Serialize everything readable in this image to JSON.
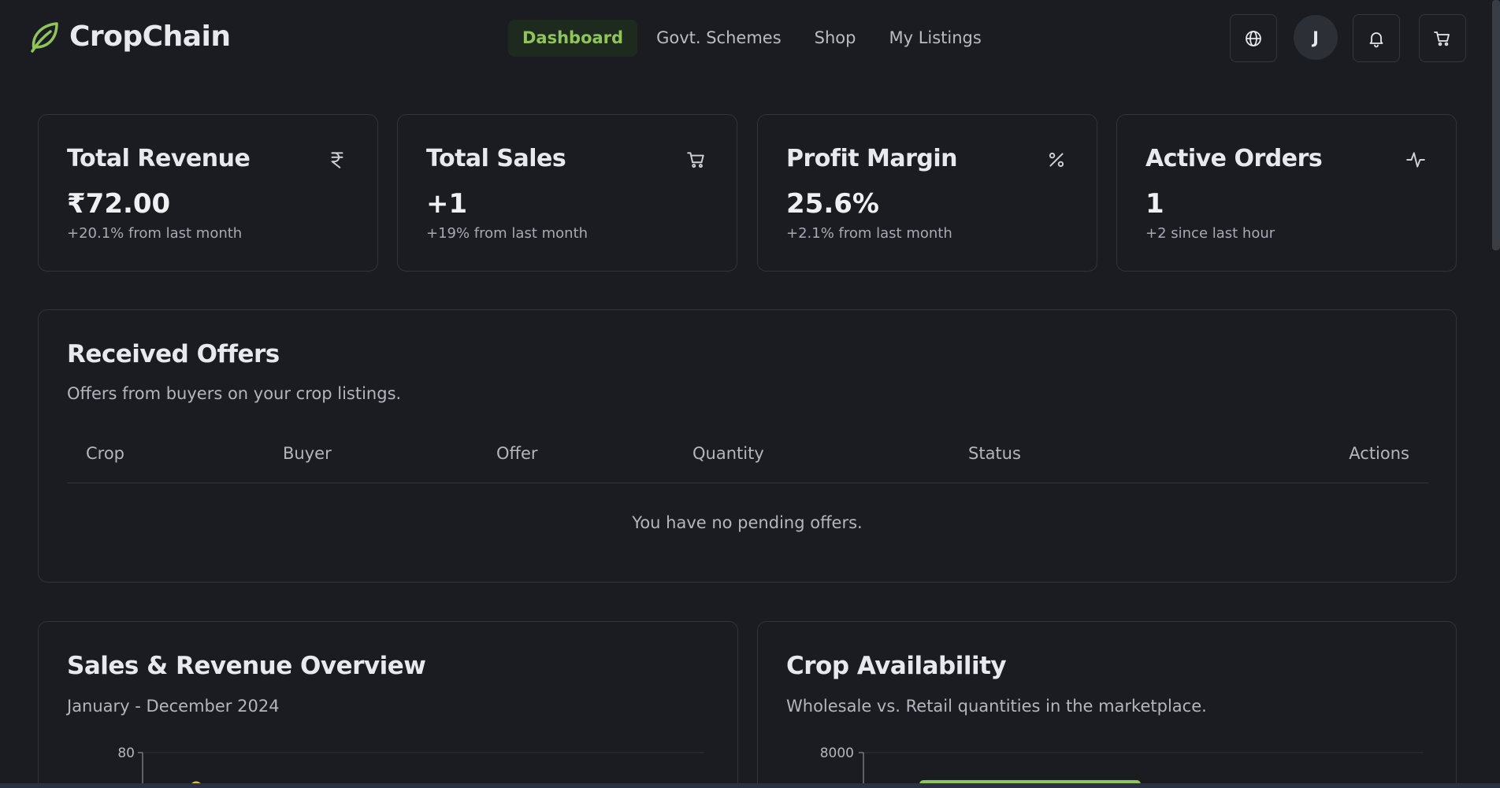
{
  "brand": {
    "name": "CropChain",
    "accent": "#8fc45a"
  },
  "nav": {
    "items": [
      {
        "label": "Dashboard",
        "active": true
      },
      {
        "label": "Govt. Schemes",
        "active": false
      },
      {
        "label": "Shop",
        "active": false
      },
      {
        "label": "My Listings",
        "active": false
      }
    ]
  },
  "header": {
    "avatar_initial": "J",
    "icons": [
      "globe-icon",
      "bell-icon",
      "cart-icon"
    ]
  },
  "stats": [
    {
      "title": "Total Revenue",
      "value": "₹72.00",
      "delta": "+20.1% from last month",
      "icon": "rupee-icon"
    },
    {
      "title": "Total Sales",
      "value": "+1",
      "delta": "+19% from last month",
      "icon": "cart-icon"
    },
    {
      "title": "Profit Margin",
      "value": "25.6%",
      "delta": "+2.1% from last month",
      "icon": "percent-icon"
    },
    {
      "title": "Active Orders",
      "value": "1",
      "delta": "+2 since last hour",
      "icon": "activity-icon"
    }
  ],
  "offers": {
    "title": "Received Offers",
    "subtitle": "Offers from buyers on your crop listings.",
    "columns": [
      "Crop",
      "Buyer",
      "Offer",
      "Quantity",
      "Status",
      "Actions"
    ],
    "empty_message": "You have no pending offers."
  },
  "chart_data": [
    {
      "type": "line",
      "title": "Sales & Revenue Overview",
      "subtitle": "January - December 2024",
      "yticks": [
        "80"
      ],
      "series_color": "#e6c33a"
    },
    {
      "type": "bar",
      "title": "Crop Availability",
      "subtitle": "Wholesale vs. Retail quantities in the marketplace.",
      "yticks": [
        "8000"
      ],
      "series_color": "#8fc45a"
    }
  ]
}
